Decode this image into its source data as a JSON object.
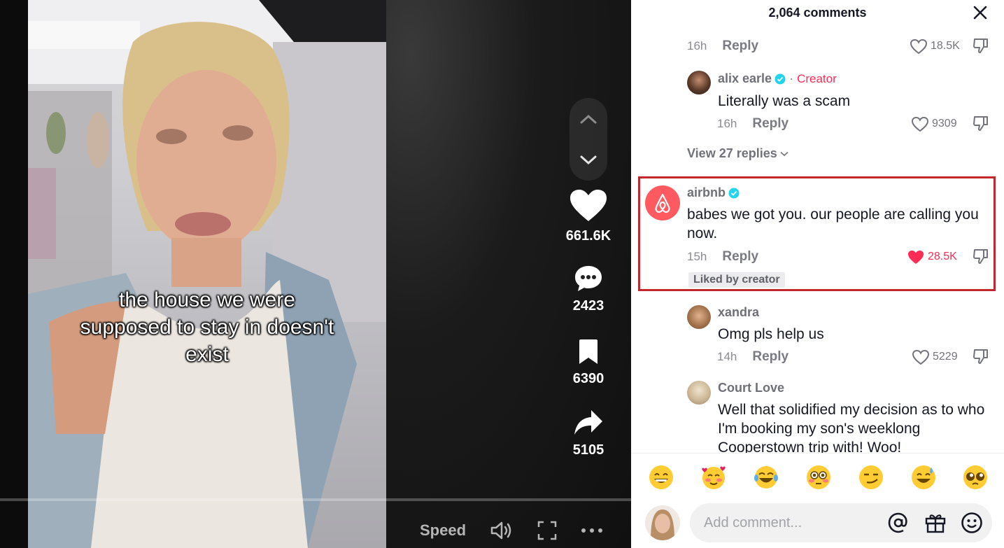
{
  "video": {
    "caption_lines": [
      "the house we were",
      "supposed to stay in doesn't",
      "exist"
    ],
    "actions": {
      "likes": "661.6K",
      "comments": "2423",
      "saves": "6390",
      "shares": "5105"
    },
    "controls": {
      "speed_label": "Speed"
    },
    "icons": [
      "chevron-up-icon",
      "chevron-down-icon",
      "heart-icon",
      "comment-bubble-icon",
      "bookmark-icon",
      "share-arrow-icon",
      "volume-icon",
      "fullscreen-icon",
      "more-icon"
    ]
  },
  "comments_panel": {
    "header": "2,064 comments",
    "top_partial": {
      "time": "16h",
      "reply": "Reply",
      "likes": "18.5K"
    },
    "comments": [
      {
        "user": "alix earle",
        "verified": true,
        "separator": "·",
        "role": "Creator",
        "text": "Literally was a scam",
        "time": "16h",
        "reply": "Reply",
        "likes": "9309"
      },
      {
        "user": "airbnb",
        "verified": true,
        "text": "babes we got you. our people are calling you now.",
        "time": "15h",
        "reply": "Reply",
        "likes": "28.5K",
        "liked": true,
        "badge": "Liked by creator"
      },
      {
        "user": "xandra",
        "text": "Omg pls help us",
        "time": "14h",
        "reply": "Reply",
        "likes": "5229"
      },
      {
        "user": "Court Love",
        "text": "Well that solidified my decision as to who I'm booking my son's weeklong Cooperstown trip with! Woo!"
      }
    ],
    "view_replies": "View 27 replies",
    "emojis": [
      "😄",
      "🥰",
      "😂",
      "😳",
      "😏",
      "😅",
      "🥺"
    ],
    "input": {
      "placeholder": "Add comment..."
    },
    "colors": {
      "creator_accent": "#fe2c55",
      "verified": "#20d5ec",
      "liked_heart": "#fe2c55",
      "highlight_box": "#c1272d",
      "airbnb": "#ff5a5f"
    }
  }
}
